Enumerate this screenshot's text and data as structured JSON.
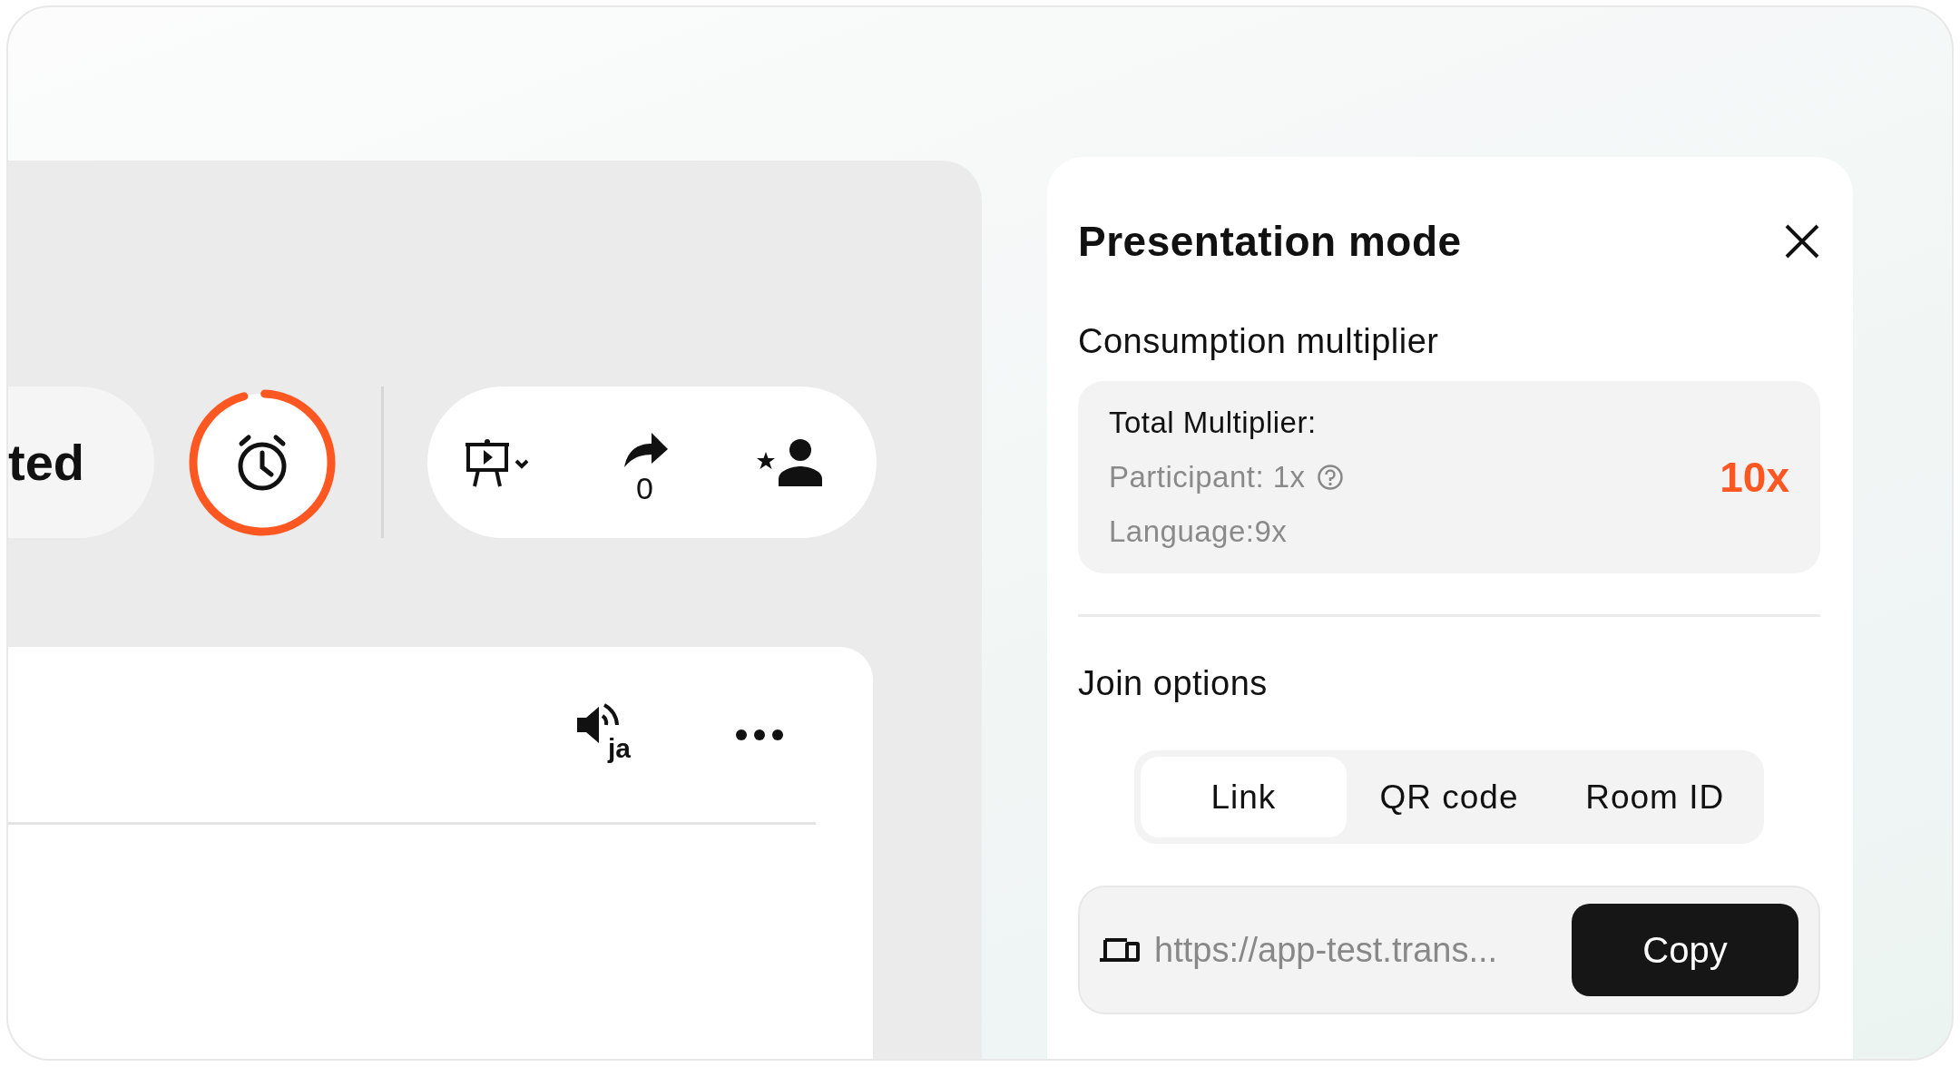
{
  "toolbar": {
    "status_label": "ted",
    "timer": {
      "level": 0.95
    },
    "share_count": "0"
  },
  "content_card": {
    "audio_language": "ja"
  },
  "panel": {
    "title": "Presentation mode",
    "multiplier": {
      "heading": "Consumption multiplier",
      "total_label": "Total Multiplier:",
      "participant": "Participant: 1x",
      "language": "Language:9x",
      "total_value": "10x"
    },
    "join": {
      "heading": "Join options",
      "tabs": [
        {
          "label": "Link",
          "selected": true
        },
        {
          "label": "QR code",
          "selected": false
        },
        {
          "label": "Room ID",
          "selected": false
        }
      ],
      "link": {
        "value": "https://app-test.trans...",
        "button": "Copy"
      }
    }
  }
}
